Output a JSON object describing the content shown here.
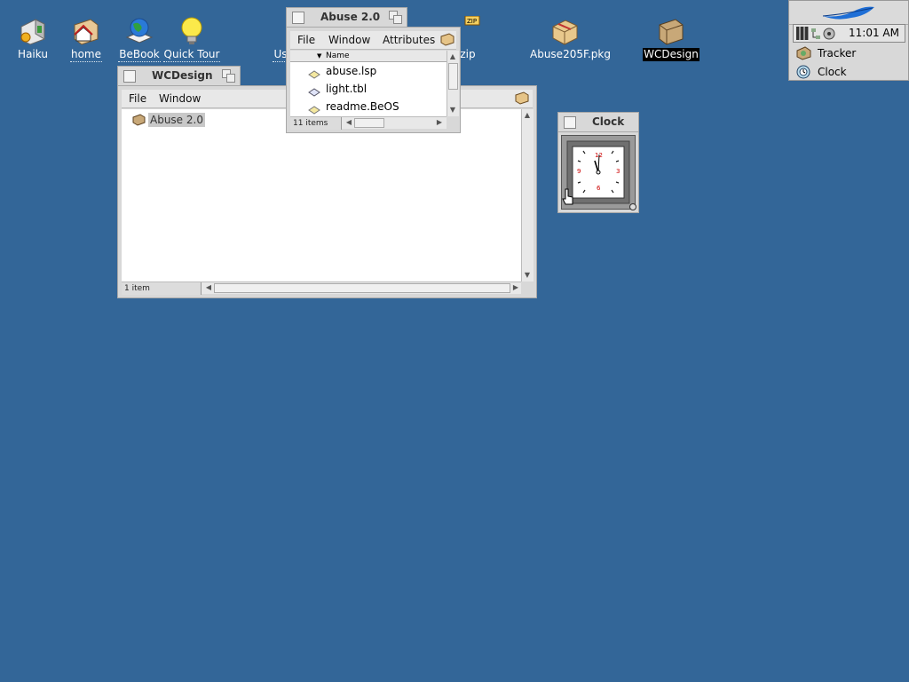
{
  "desktop": {
    "icons": [
      {
        "label": "Haiku",
        "icon": "haiku-volume-icon"
      },
      {
        "label": "home",
        "icon": "home-folder-icon"
      },
      {
        "label": "BeBook",
        "icon": "bebook-globe-icon"
      },
      {
        "label": "Quick Tour",
        "icon": "lightbulb-icon"
      },
      {
        "label": "Us",
        "icon": "user-guide-icon"
      },
      {
        "label": "zip",
        "icon": "zip-archive-icon"
      },
      {
        "label": "Abuse205F.pkg",
        "icon": "package-icon"
      },
      {
        "label": "WCDesign",
        "icon": "folder-icon"
      }
    ]
  },
  "wcdesign_window": {
    "title": "WCDesign",
    "menu": [
      "File",
      "Window"
    ],
    "items": [
      {
        "name": "Abuse 2.0",
        "icon": "folder-icon"
      }
    ],
    "status": "1 item"
  },
  "abuse_window": {
    "title": "Abuse 2.0",
    "menu": [
      "File",
      "Window",
      "Attributes"
    ],
    "column_header": "Name",
    "files": [
      {
        "name": "abuse.lsp",
        "icon": "text-file-icon"
      },
      {
        "name": "light.tbl",
        "icon": "data-file-icon"
      },
      {
        "name": "readme.BeOS",
        "icon": "text-file-icon"
      }
    ],
    "status": "11 items"
  },
  "clock_window": {
    "title": "Clock",
    "face_numbers": {
      "twelve": "12",
      "three": "3",
      "six": "6",
      "nine": "9"
    }
  },
  "deskbar": {
    "time": "11:01 AM",
    "items": [
      {
        "label": "Tracker",
        "icon": "tracker-icon"
      },
      {
        "label": "Clock",
        "icon": "clock-app-icon"
      }
    ]
  },
  "colors": {
    "desktop": "#336698",
    "window_frame": "#d8d8d8",
    "selection": "#000000"
  }
}
